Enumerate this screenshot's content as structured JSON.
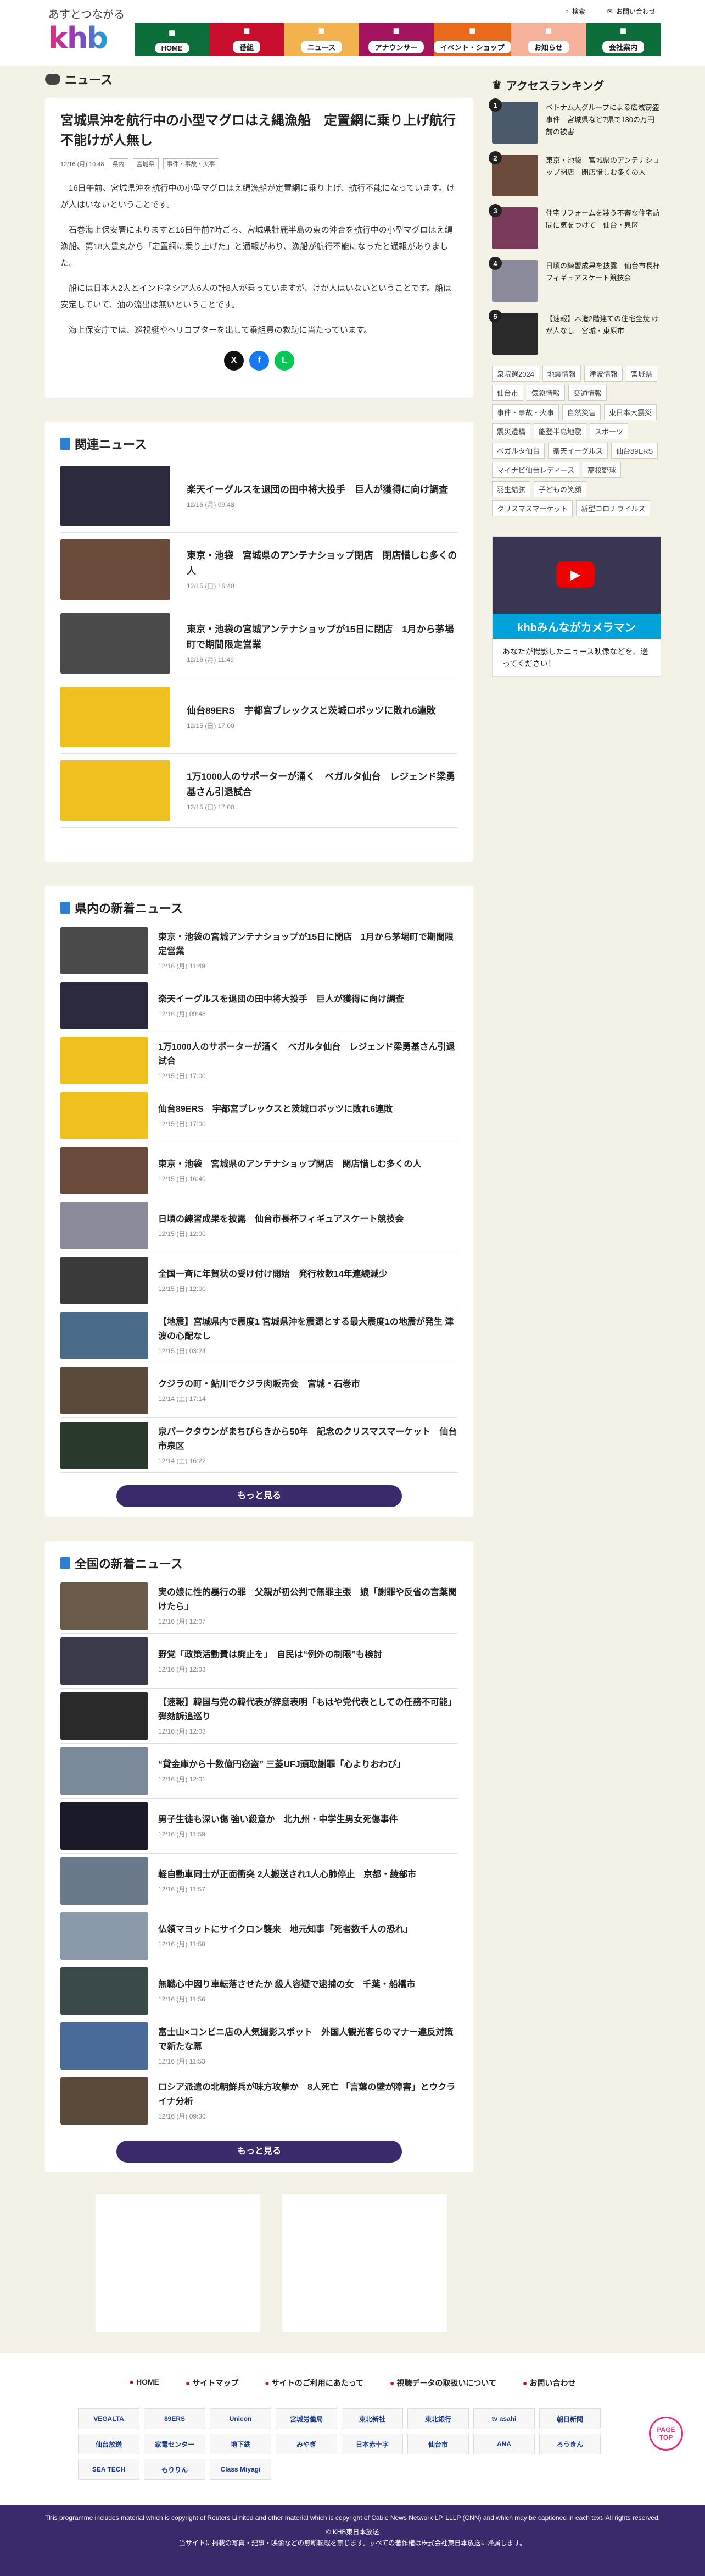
{
  "header": {
    "tagline": "あすとつながる",
    "logo": "khb",
    "util": {
      "search": "検索",
      "contact": "お問い合わせ"
    },
    "nav": [
      {
        "label": "HOME",
        "color": "#0d6d3b",
        "icon": "home-icon"
      },
      {
        "label": "番組",
        "color": "#c8102e",
        "icon": "tv-icon"
      },
      {
        "label": "ニュース",
        "color": "#f2b24d",
        "icon": "news-icon"
      },
      {
        "label": "アナウンサー",
        "color": "#a4145e",
        "icon": "mic-icon"
      },
      {
        "label": "イベント・ショップ",
        "color": "#e96a1a",
        "icon": "event-icon"
      },
      {
        "label": "お知らせ",
        "color": "#f6b19b",
        "icon": "bell-icon"
      },
      {
        "label": "会社案内",
        "color": "#0d6d3b",
        "icon": "building-icon"
      }
    ]
  },
  "article": {
    "section": "ニュース",
    "title": "宮城県沖を航行中の小型マグロはえ縄漁船　定置網に乗り上げ航行不能けが人無し",
    "date": "12/16 (月) 10:48",
    "tags": [
      "県内",
      "宮城県",
      "事件・事故・火事"
    ],
    "paragraphs": [
      "16日午前、宮城県沖を航行中の小型マグロはえ縄漁船が定置網に乗り上げ、航行不能になっています。けが人はいないということです。",
      "石巻海上保安署によりますと16日午前7時ごろ、宮城県牡鹿半島の東の沖合を航行中の小型マグロはえ縄漁船、第18大豊丸から「定置網に乗り上げた」と通報があり、漁船が航行不能になったと通報がありました。",
      "船には日本人2人とインドネシア人6人の計8人が乗っていますが、けが人はいないということです。船は安定していて、油の流出は無いということです。",
      "海上保安庁では、巡視艇やヘリコプターを出して乗組員の救助に当たっています。"
    ],
    "share": [
      {
        "name": "x-icon",
        "label": "X",
        "color": "#111"
      },
      {
        "name": "facebook-icon",
        "label": "f",
        "color": "#1877f2"
      },
      {
        "name": "line-icon",
        "label": "L",
        "color": "#06c755"
      }
    ]
  },
  "related": {
    "title": "関連ニュース",
    "items": [
      {
        "title": "楽天イーグルスを退団の田中将大投手　巨人が獲得に向け調査",
        "date": "12/16 (月) 09:48",
        "color": "#2b2b3d"
      },
      {
        "title": "東京・池袋　宮城県のアンテナショップ閉店　閉店惜しむ多くの人",
        "date": "12/15 (日) 16:40",
        "color": "#6a4a3a"
      },
      {
        "title": "東京・池袋の宮城アンテナショップが15日に閉店　1月から茅場町で期間限定営業",
        "date": "12/16 (月) 11:49",
        "color": "#4a4a4a"
      },
      {
        "title": "仙台89ERS　宇都宮ブレックスと茨城ロボッツに敗れ6連敗",
        "date": "12/15 (日) 17:00",
        "color": "#f0c020"
      },
      {
        "title": "1万1000人のサポーターが涌く　ベガルタ仙台　レジェンド梁勇基さん引退試合",
        "date": "12/15 (日) 17:00",
        "color": "#f0c020"
      }
    ]
  },
  "local": {
    "title": "県内の新着ニュース",
    "more": "もっと見る",
    "items": [
      {
        "title": "東京・池袋の宮城アンテナショップが15日に閉店　1月から茅場町で期間限定営業",
        "date": "12/16 (月) 11:49",
        "color": "#4a4a4a"
      },
      {
        "title": "楽天イーグルスを退団の田中将大投手　巨人が獲得に向け調査",
        "date": "12/16 (月) 09:48",
        "color": "#2b2b3d"
      },
      {
        "title": "1万1000人のサポーターが涌く　ベガルタ仙台　レジェンド梁勇基さん引退試合",
        "date": "12/15 (日) 17:00",
        "color": "#f0c020"
      },
      {
        "title": "仙台89ERS　宇都宮ブレックスと茨城ロボッツに敗れ6連敗",
        "date": "12/15 (日) 17:00",
        "color": "#f0c020"
      },
      {
        "title": "東京・池袋　宮城県のアンテナショップ閉店　閉店惜しむ多くの人",
        "date": "12/15 (日) 16:40",
        "color": "#6a4a3a"
      },
      {
        "title": "日頃の練習成果を披露　仙台市長杯フィギュアスケート競技会",
        "date": "12/15 (日) 12:00",
        "color": "#8a8a9a"
      },
      {
        "title": "全国一斉に年賀状の受け付け開始　発行枚数14年連続減少",
        "date": "12/15 (日) 12:00",
        "color": "#3a3a3a"
      },
      {
        "title": "【地震】宮城県内で震度1 宮城県沖を震源とする最大震度1の地震が発生 津波の心配なし",
        "date": "12/15 (日) 03:24",
        "color": "#4a6a8a"
      },
      {
        "title": "クジラの町・鮎川でクジラ肉販売会　宮城・石巻市",
        "date": "12/14 (土) 17:14",
        "color": "#5a4a3a"
      },
      {
        "title": "泉パークタウンがまちびらきから50年　記念のクリスマスマーケット　仙台市泉区",
        "date": "12/14 (土) 16:22",
        "color": "#2a3a2a"
      }
    ]
  },
  "national": {
    "title": "全国の新着ニュース",
    "more": "もっと見る",
    "items": [
      {
        "title": "実の娘に性的暴行の罪　父親が初公判で無罪主張　娘「謝罪や反省の言葉聞けたら」",
        "date": "12/16 (月) 12:07",
        "color": "#6a5a4a"
      },
      {
        "title": "野党「政策活動費は廃止を」　自民は“例外の制限”も検討",
        "date": "12/16 (月) 12:03",
        "color": "#3a3a4a"
      },
      {
        "title": "【速報】韓国与党の韓代表が辞意表明「もはや党代表としての任務不可能」弾劾訴追巡り",
        "date": "12/16 (月) 12:03",
        "color": "#2a2a2a"
      },
      {
        "title": "“貸金庫から十数億円窃盗” 三菱UFJ頭取謝罪「心よりおわび」",
        "date": "12/16 (月) 12:01",
        "color": "#7a8a9a"
      },
      {
        "title": "男子生徒も深い傷 強い殺意か　北九州・中学生男女死傷事件",
        "date": "12/16 (月) 11:59",
        "color": "#1a1a2a"
      },
      {
        "title": "軽自動車同士が正面衝突 2人搬送され1人心肺停止　京都・綾部市",
        "date": "12/16 (月) 11:57",
        "color": "#6a7a8a"
      },
      {
        "title": "仏領マヨットにサイクロン襲来　地元知事「死者数千人の恐れ」",
        "date": "12/16 (月) 11:58",
        "color": "#8a9aaa"
      },
      {
        "title": "無職心中図り車転落させたか 殺人容疑で逮捕の女　千葉・船橋市",
        "date": "12/16 (月) 11:56",
        "color": "#3a4a4a"
      },
      {
        "title": "富士山×コンビニ店の人気撮影スポット　外国人観光客らのマナー違反対策で新たな幕",
        "date": "12/16 (月) 11:53",
        "color": "#4a6a9a"
      },
      {
        "title": "ロシア派遣の北朝鮮兵が味方攻撃か　8人死亡 「言葉の壁が障害」とウクライナ分析",
        "date": "12/16 (月) 09:30",
        "color": "#5a4a3a"
      }
    ]
  },
  "sidebar": {
    "ranking_title": "アクセスランキング",
    "ranking": [
      {
        "title": "ベトナム人グループによる広域窃盗事件　宮城県など7県で130の万円前の被害",
        "color": "#4a5a6a"
      },
      {
        "title": "東京・池袋　宮城県のアンテナショップ閉店　閉店惜しむ多くの人",
        "color": "#6a4a3a"
      },
      {
        "title": "住宅リフォームを装う不審な住宅訪問に気をつけて　仙台・泉区",
        "color": "#7a3a5a"
      },
      {
        "title": "日頃の練習成果を披露　仙台市長杯フィギュアスケート競技会",
        "color": "#8a8a9a"
      },
      {
        "title": "【速報】木造2階建ての住宅全焼 けが人なし　宮城・東原市",
        "color": "#2a2a2a"
      }
    ],
    "tags": [
      "衆院選2024",
      "地震情報",
      "津波情報",
      "宮城県",
      "仙台市",
      "気象情報",
      "交通情報",
      "事件・事故・火事",
      "自然災害",
      "東日本大震災",
      "震災遺構",
      "能登半島地震",
      "スポーツ",
      "ベガルタ仙台",
      "楽天イーグルス",
      "仙台89ERS",
      "マイナビ仙台レディース",
      "高校野球",
      "羽生結弦",
      "子どもの笑顔",
      "クリスマスマーケット",
      "新型コロナウイルス"
    ],
    "cameraman": {
      "bar": "khbみんながカメラマン",
      "text": "あなたが撮影したニュース映像などを、送ってください！"
    }
  },
  "footer": {
    "links": [
      "HOME",
      "サイトマップ",
      "サイトのご利用にあたって",
      "視聴データの取扱いについて",
      "お問い合わせ"
    ],
    "sponsors": [
      "VEGALTA",
      "89ERS",
      "Unicon",
      "宮城労働局",
      "東北新社",
      "東北銀行",
      "tv asahi",
      "朝日新聞",
      "仙台放送",
      "家電センター",
      "地下鉄",
      "みやぎ",
      "日本赤十字",
      "仙台市",
      "ANA",
      "ろうきん",
      "SEA TECH",
      "もりりん",
      "Class Miyagi"
    ],
    "copyright1": "This programme includes material which is copyright of Reuters Limited and other material which is copyright of Cable News Network LP, LLLP (CNN) and which may be captioned in each text. All rights reserved.",
    "copyright2": "© KHB東日本放送",
    "copyright3": "当サイトに掲載の写真・記事・映像などの無断転載を禁じます。すべての著作権は株式会社東日本放送に帰属します。",
    "pagetop": "PAGE TOP"
  }
}
